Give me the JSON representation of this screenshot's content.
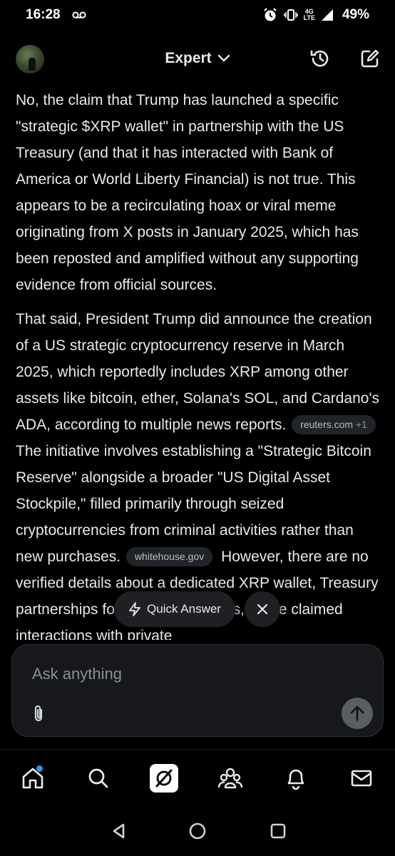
{
  "status": {
    "time": "16:28",
    "network": "4G",
    "network_sub": "LTE",
    "battery": "49%"
  },
  "header": {
    "title": "Expert"
  },
  "message": {
    "p1": "No, the claim that Trump has launched a specific \"strategic $XRP wallet\" in partnership with the US Treasury (and that it has interacted with Bank of America or World Liberty Financial) is not true. This appears to be a recirculating hoax or viral meme originating from X posts in January 2025, which has been reposted and amplified without any supporting evidence from official sources.",
    "p2_a": "That said, President Trump did announce the creation of a US strategic cryptocurrency reserve in March 2025, which reportedly includes XRP among other assets like bitcoin, ether, Solana's SOL, and Cardano's ADA, according to multiple news reports.",
    "source1": "reuters.com",
    "source1_more": "+1",
    "p2_b": "The initiative involves establishing a \"Strategic Bitcoin Reserve\" alongside a broader \"US Digital Asset Stockpile,\" filled primarily through seized cryptocurrencies from criminal activities rather than new purchases.",
    "source2": "whitehouse.gov",
    "p2_c": "However, there are no verified details about a dedicated XRP wallet, Treasury partnerships for its specific assets, or the claimed interactions with private"
  },
  "quick_answer": {
    "label": "Quick Answer"
  },
  "composer": {
    "placeholder": "Ask anything"
  },
  "nav": {
    "items": [
      "home-icon",
      "search-icon",
      "grok-icon",
      "communities-icon",
      "notifications-icon",
      "messages-icon"
    ],
    "accent": "#1d9bf0"
  }
}
